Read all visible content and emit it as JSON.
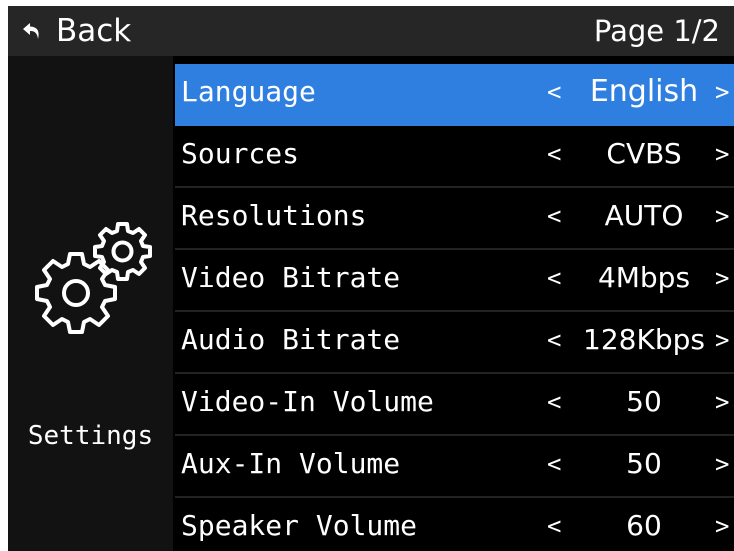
{
  "header": {
    "back_label": "Back",
    "page_indicator": "Page 1/2"
  },
  "sidebar": {
    "label": "Settings",
    "icon": "gears-icon"
  },
  "menu": {
    "selected_index": 0,
    "items": [
      {
        "label": "Language",
        "value": "English"
      },
      {
        "label": "Sources",
        "value": "CVBS"
      },
      {
        "label": "Resolutions",
        "value": "AUTO"
      },
      {
        "label": "Video Bitrate",
        "value": "4Mbps"
      },
      {
        "label": "Audio Bitrate",
        "value": "128Kbps"
      },
      {
        "label": "Video-In Volume",
        "value": "50"
      },
      {
        "label": "Aux-In Volume",
        "value": "50"
      },
      {
        "label": "Speaker Volume",
        "value": "60"
      }
    ],
    "arrow_left": "<",
    "arrow_right": ">"
  },
  "colors": {
    "selected_row": "#2f7fe0",
    "topbar": "#262626",
    "background": "#000000",
    "text": "#ffffff"
  }
}
